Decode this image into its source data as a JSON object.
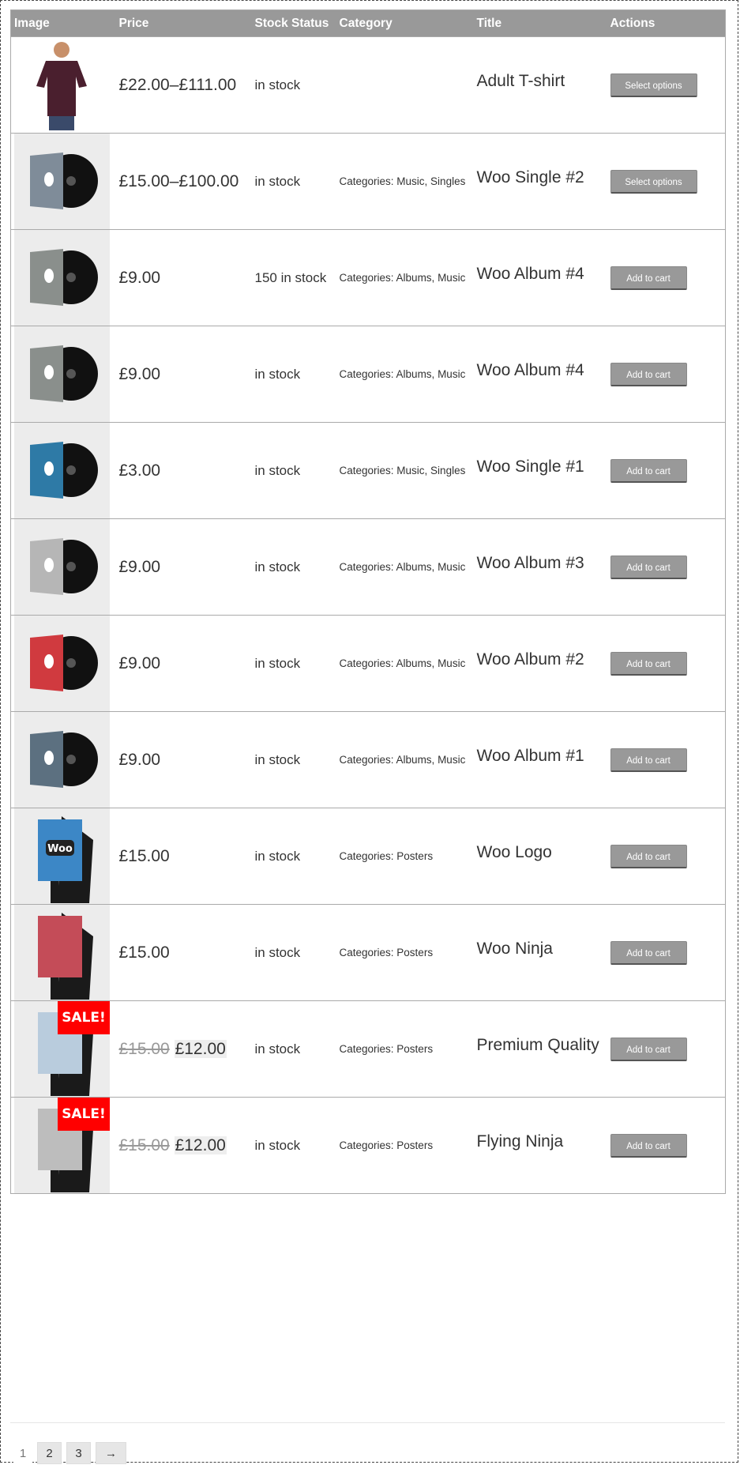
{
  "headers": {
    "image": "Image",
    "price": "Price",
    "stock": "Stock Status",
    "category": "Category",
    "title": "Title",
    "actions": "Actions"
  },
  "category_prefix": "Categories: ",
  "sale_badge": "SALE!",
  "products": [
    {
      "price": "£22.00–£111.00",
      "stock": "in stock",
      "cats": "",
      "title": "Adult T-shirt",
      "action": "Select options",
      "image": "tshirt"
    },
    {
      "price": "£15.00–£100.00",
      "stock": "in stock",
      "cats": "Music, Singles",
      "title": "Woo Single #2",
      "action": "Select options",
      "image": "album-gray-woo"
    },
    {
      "price": "£9.00",
      "stock": "150 in stock",
      "cats": "Albums, Music",
      "title": "Woo Album #4",
      "action": "Add to cart",
      "image": "album-gray"
    },
    {
      "price": "£9.00",
      "stock": "in stock",
      "cats": "Albums, Music",
      "title": "Woo Album #4",
      "action": "Add to cart",
      "image": "album-gray"
    },
    {
      "price": "£3.00",
      "stock": "in stock",
      "cats": "Music, Singles",
      "title": "Woo Single #1",
      "action": "Add to cart",
      "image": "album-blue"
    },
    {
      "price": "£9.00",
      "stock": "in stock",
      "cats": "Albums, Music",
      "title": "Woo Album #3",
      "action": "Add to cart",
      "image": "album-light"
    },
    {
      "price": "£9.00",
      "stock": "in stock",
      "cats": "Albums, Music",
      "title": "Woo Album #2",
      "action": "Add to cart",
      "image": "album-red"
    },
    {
      "price": "£9.00",
      "stock": "in stock",
      "cats": "Albums, Music",
      "title": "Woo Album #1",
      "action": "Add to cart",
      "image": "album-slate"
    },
    {
      "price": "£15.00",
      "stock": "in stock",
      "cats": "Posters",
      "title": "Woo Logo",
      "action": "Add to cart",
      "image": "poster-woo"
    },
    {
      "price": "£15.00",
      "stock": "in stock",
      "cats": "Posters",
      "title": "Woo Ninja",
      "action": "Add to cart",
      "image": "poster-ninja"
    },
    {
      "price_old": "£15.00",
      "price_new": "£12.00",
      "stock": "in stock",
      "cats": "Posters",
      "title": "Premium Quality",
      "action": "Add to cart",
      "image": "poster-premium",
      "sale": true
    },
    {
      "price_old": "£15.00",
      "price_new": "£12.00",
      "stock": "in stock",
      "cats": "Posters",
      "title": "Flying Ninja",
      "action": "Add to cart",
      "image": "poster-flying",
      "sale": true
    }
  ],
  "pagination": {
    "pages": [
      "1",
      "2",
      "3"
    ],
    "next": "→",
    "current": "1"
  }
}
